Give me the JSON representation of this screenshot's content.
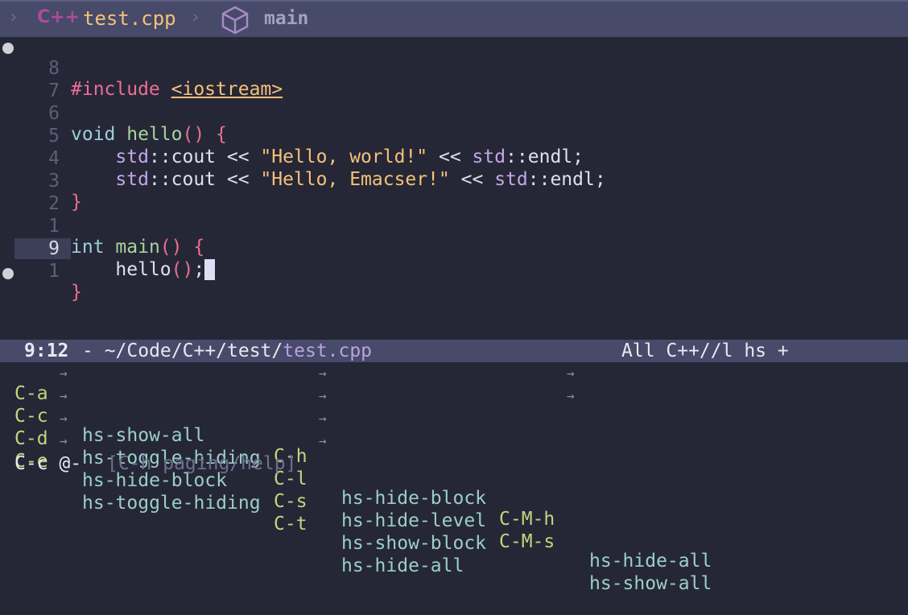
{
  "header": {
    "breadcrumb_sep": "›",
    "language_icon_label": "C++",
    "filename": "test.cpp",
    "branch": "main",
    "icons": [
      "chevron-right-icon",
      "cplusplus-icon",
      "cube-icon"
    ]
  },
  "editor": {
    "lines": [
      {
        "num": "8"
      },
      {
        "num": "7"
      },
      {
        "num": "6"
      },
      {
        "num": "5"
      },
      {
        "num": "4"
      },
      {
        "num": "3"
      },
      {
        "num": "2"
      },
      {
        "num": "1"
      },
      {
        "num": "9"
      },
      {
        "num": "1"
      }
    ],
    "code": {
      "l8_pp": "#include",
      "l8_hdr": "<iostream>",
      "l6_type": "void",
      "l6_fn": "hello",
      "l6_open": "() {",
      "l5_ns": "std",
      "l5_op1": "::cout << ",
      "l5_str": "\"Hello, world!\"",
      "l5_op2": " << ",
      "l5_ns2": "std",
      "l5_end": "::endl;",
      "l4_ns": "std",
      "l4_op1": "::cout << ",
      "l4_str": "\"Hello, Emacser!\"",
      "l4_op2": " << ",
      "l4_ns2": "std",
      "l4_end": "::endl;",
      "l3_close": "}",
      "l1_type": "int",
      "l1_fn": "main",
      "l1_open": "() {",
      "l9_call": "hello",
      "l9_paren": "()",
      "l9_semi": ";",
      "l1b_close": "}"
    }
  },
  "modeline": {
    "position": "9:12",
    "path_prefix": "- ~/Code/C++/test/",
    "path_file": "test.cpp",
    "right": "All C++//l hs +"
  },
  "whichkey": {
    "rows": [
      [
        {
          "key": "C-a",
          "cmd": "hs-show-all"
        },
        {
          "key": "C-h",
          "cmd": "hs-hide-block"
        },
        {
          "key": "C-M-h",
          "cmd": "hs-hide-all"
        }
      ],
      [
        {
          "key": "C-c",
          "cmd": "hs-toggle-hiding"
        },
        {
          "key": "C-l",
          "cmd": "hs-hide-level"
        },
        {
          "key": "C-M-s",
          "cmd": "hs-show-all"
        }
      ],
      [
        {
          "key": "C-d",
          "cmd": "hs-hide-block"
        },
        {
          "key": "C-s",
          "cmd": "hs-show-block"
        }
      ],
      [
        {
          "key": "C-e",
          "cmd": "hs-toggle-hiding"
        },
        {
          "key": "C-t",
          "cmd": "hs-hide-all"
        }
      ]
    ],
    "arrow": "→"
  },
  "echo": {
    "prefix": "C-c @-",
    "hint": "[C-h paging/help]"
  },
  "colors": {
    "background": "#252737",
    "bar": "#474a69",
    "keyword": "#9ccfd8",
    "string": "#f6c177",
    "namespace": "#c4a7e7",
    "paren": "#eb6f92",
    "function": "#a8d39b",
    "wk_key": "#c6d37a",
    "wk_cmd": "#9ccfc4"
  }
}
